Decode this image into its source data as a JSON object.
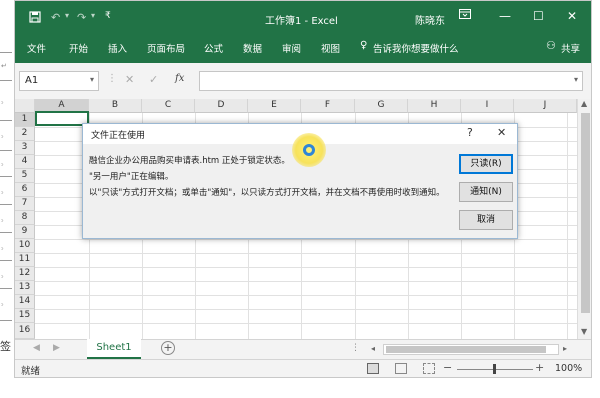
{
  "app": {
    "title": "工作簿1 - Excel",
    "user": "陈晓东",
    "share_label": "共享",
    "accent": "#217346"
  },
  "ribbon_tabs": [
    "文件",
    "开始",
    "插入",
    "页面布局",
    "公式",
    "数据",
    "审阅",
    "视图"
  ],
  "tell_me": "告诉我你想要做什么",
  "formula_bar": {
    "name_box": "A1",
    "fx_label": "fx",
    "value": ""
  },
  "columns": [
    "A",
    "B",
    "C",
    "D",
    "E",
    "F",
    "G",
    "H",
    "I",
    "J"
  ],
  "rows": [
    "1",
    "2",
    "3",
    "4",
    "5",
    "6",
    "7",
    "8",
    "9",
    "10",
    "11",
    "12",
    "13",
    "14",
    "15",
    "16"
  ],
  "sheet_tabs": [
    "Sheet1"
  ],
  "status": {
    "ready": "就绪",
    "zoom": "100%"
  },
  "dialog": {
    "title": "文件正在使用",
    "help": "?",
    "line1": "融信企业办公用品购买申请表.htm 正处于锁定状态。",
    "line2": "\"另一用户\"正在编辑。",
    "line3": "以\"只读\"方式打开文档；或单击\"通知\"，以只读方式打开文档，并在文档不再使用时收到通知。",
    "btn_readonly": "只读(R)",
    "btn_notify": "通知(N)",
    "btn_cancel": "取消"
  },
  "left_fragment": "签",
  "icons": [
    "save-icon",
    "undo-icon",
    "redo-icon",
    "customize-qat-icon",
    "ribbon-options-icon",
    "minimize-icon",
    "maximize-icon",
    "close-icon",
    "lightbulb-icon",
    "person-icon",
    "cancel-formula-icon",
    "enter-formula-icon",
    "busy-spinner-icon"
  ]
}
